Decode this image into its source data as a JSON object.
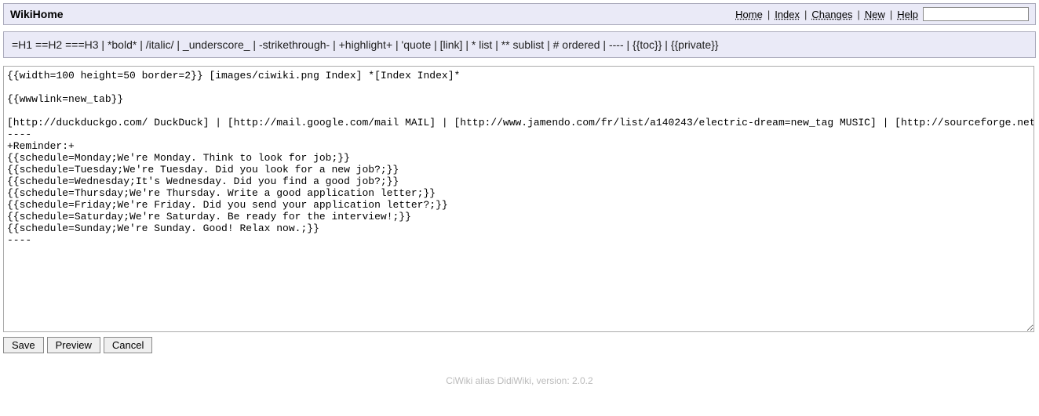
{
  "header": {
    "title": "WikiHome",
    "nav": {
      "home": "Home",
      "index": "Index",
      "changes": "Changes",
      "new": "New",
      "help": "Help"
    },
    "search_value": ""
  },
  "toolbar": {
    "text": "=H1 ==H2 ===H3 | *bold* | /italic/ | _underscore_ | -strikethrough- | +highlight+ | 'quote | [link] | * list | ** sublist | # ordered | ---- | {{toc}} | {{private}}"
  },
  "editor": {
    "content": "{{width=100 height=50 border=2}} [images/ciwiki.png Index] *[Index Index]*\n\n{{wwwlink=new_tab}}\n\n[http://duckduckgo.com/ DuckDuck] | [http://mail.google.com/mail MAIL] | [http://www.jamendo.com/fr/list/a140243/electric-dream=new_tag MUSIC] | [http://sourceforge.net/ SourceForge]\n----\n+Reminder:+\n{{schedule=Monday;We're Monday. Think to look for job;}}\n{{schedule=Tuesday;We're Tuesday. Did you look for a new job?;}}\n{{schedule=Wednesday;It's Wednesday. Did you find a good job?;}}\n{{schedule=Thursday;We're Thursday. Write a good application letter;}}\n{{schedule=Friday;We're Friday. Did you send your application letter?;}}\n{{schedule=Saturday;We're Saturday. Be ready for the interview!;}}\n{{schedule=Sunday;We're Sunday. Good! Relax now.;}}\n----"
  },
  "buttons": {
    "save": "Save",
    "preview": "Preview",
    "cancel": "Cancel"
  },
  "footer": {
    "text": "CiWiki alias DidiWiki, version: 2.0.2"
  }
}
